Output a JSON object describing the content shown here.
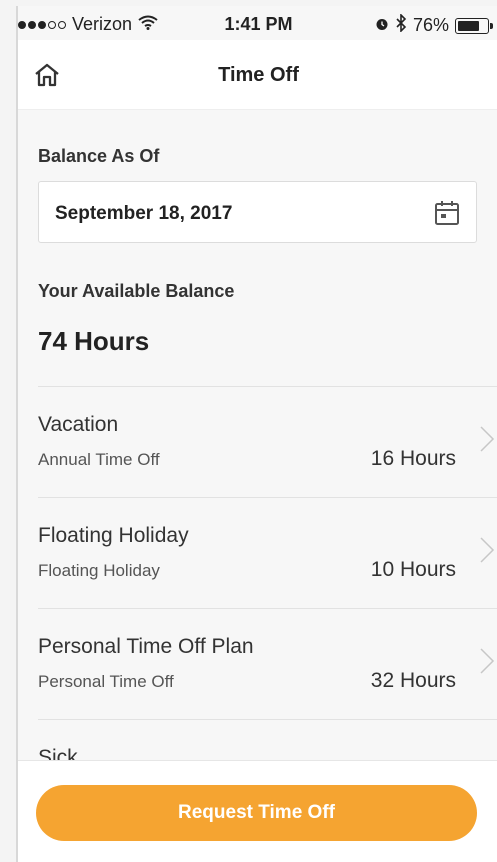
{
  "status_bar": {
    "carrier": "Verizon",
    "time": "1:41 PM",
    "battery": "76%",
    "battery_level": 0.76,
    "signal_dots_filled": 3,
    "signal_dots_total": 5,
    "icons": [
      "wifi-icon",
      "alarm-icon",
      "bluetooth-icon",
      "battery-icon"
    ]
  },
  "header": {
    "title": "Time Off",
    "home_icon": "home-icon"
  },
  "balance": {
    "as_of_label": "Balance As Of",
    "date": "September 18, 2017",
    "calendar_icon": "calendar-icon",
    "available_label": "Your Available Balance",
    "total": "74 Hours"
  },
  "plans": [
    {
      "name": "Vacation",
      "type": "Annual Time Off",
      "hours": "16 Hours"
    },
    {
      "name": "Floating Holiday",
      "type": "Floating Holiday",
      "hours": "10 Hours"
    },
    {
      "name": "Personal Time Off Plan",
      "type": "Personal Time Off",
      "hours": "32 Hours"
    },
    {
      "name": "Sick",
      "type": "",
      "hours": ""
    }
  ],
  "footer": {
    "request_button": "Request Time Off"
  },
  "colors": {
    "accent": "#f5a431",
    "background": "#f7f7f7",
    "text": "#333333"
  }
}
